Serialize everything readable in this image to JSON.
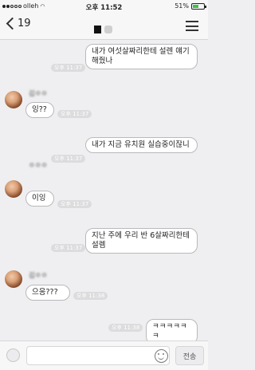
{
  "status_bar": {
    "carrier": "olleh",
    "time": "오후 11:52",
    "battery_pct": "51%",
    "battery_level": 0.51,
    "battery_color": "#3cc34a"
  },
  "nav": {
    "back_count": "19",
    "back_icon": "chevron-left-icon",
    "menu_icon": "hamburger-menu-icon"
  },
  "messages": [
    {
      "side": "out",
      "text": "내가 여섯살짜리한테 설렌 얘기 해줬나",
      "time": "오후 11:37"
    },
    {
      "side": "in",
      "text": "잉??",
      "time": "오후 11:37"
    },
    {
      "side": "out",
      "text": "내가 지금 유치원 실습중이잖니",
      "time": "오후 11:37"
    },
    {
      "side": "in",
      "text": "이잉",
      "time": "오후 11:37"
    },
    {
      "side": "out",
      "text": "지난 주에 우리 반 6살짜리한테 설렘",
      "time": "오후 11:37"
    },
    {
      "side": "in",
      "text": "으응???",
      "time": "오후 11:38"
    },
    {
      "side": "out",
      "text": "ㅋㅋㅋㅋㅋㅋ",
      "time": "오후 11:38"
    }
  ],
  "input_bar": {
    "placeholder": "",
    "send_label": "전송",
    "emoji_icon": "smiley-icon",
    "plus_icon": "plus-circle-icon"
  },
  "colors": {
    "chat_bg": "#efeff1",
    "bubble_bg": "#ffffff",
    "bubble_border": "#b9b9bd"
  }
}
